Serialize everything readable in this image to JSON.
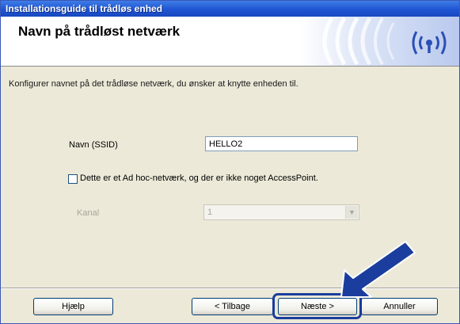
{
  "window": {
    "title": "Installationsguide til trådløs enhed"
  },
  "header": {
    "title": "Navn på trådløst netværk",
    "logo_icon": "wireless-signal-icon"
  },
  "instruction": "Konfigurer navnet på det trådløse netværk, du ønsker at knytte enheden til.",
  "form": {
    "ssid_label": "Navn (SSID)",
    "ssid_value": "HELLO2",
    "adhoc_label": "Dette er et Ad hoc-netværk, og der er ikke noget AccessPoint.",
    "adhoc_checked": false,
    "channel_label": "Kanal",
    "channel_value": "1",
    "channel_enabled": false
  },
  "buttons": {
    "help": "Hjælp",
    "back": "< Tilbage",
    "next": "Næste >",
    "cancel": "Annuller"
  },
  "colors": {
    "titlebar": "#1f55d2",
    "dialog_background": "#ece9d8",
    "accent_blue": "#1b3d9e",
    "logo_blue": "#2a4fb5"
  }
}
